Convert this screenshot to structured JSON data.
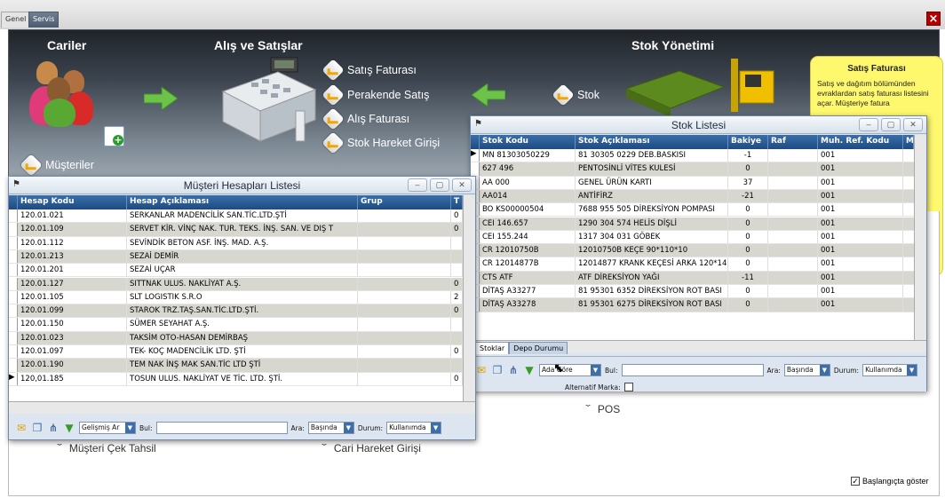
{
  "tabs": [
    {
      "label": "Genel"
    },
    {
      "label": "Servis"
    }
  ],
  "hero": {
    "cariler": "Cariler",
    "alis_satis": "Alış ve Satışlar",
    "stok_yonetimi": "Stok Yönetimi",
    "musteriler": "Müşteriler",
    "menu": [
      "Satış Faturası",
      "Perakende Satış",
      "Alış Faturası",
      "Stok Hareket Girişi"
    ],
    "stok": "Stok",
    "info_title": "Satış Faturası",
    "info_text": "Satış ve dağıtım bölümünden evraklardan satış faturası listesini açar. Müşteriye fatura"
  },
  "hidden_labels": {
    "left": "Müşteri Çek Tahsil",
    "mid": "Cari Hareket Girişi",
    "pos": "POS"
  },
  "musteri_window": {
    "title": "Müşteri Hesapları Listesi",
    "columns": [
      "Hesap Kodu",
      "Hesap Açıklaması",
      "Grup",
      "T"
    ],
    "rows": [
      [
        "120.01.021",
        "SERKANLAR MADENCİLİK SAN.TİC.LTD.ŞTİ",
        "",
        "0"
      ],
      [
        "120.01.109",
        "SERVET KİR. VİNÇ NAK. TUR. TEKS. İNŞ. SAN. VE DIŞ T",
        "",
        "0"
      ],
      [
        "120.01.112",
        "SEVİNDİK BETON ASF. İNŞ. MAD. A.Ş.",
        "",
        ""
      ],
      [
        "120.01.213",
        "SEZAİ DEMİR",
        "",
        ""
      ],
      [
        "120.01.201",
        "SEZAİ UÇAR",
        "",
        ""
      ],
      [
        "120.01.127",
        "SITTNAK ULUS. NAKLİYAT A.Ş.",
        "",
        "0"
      ],
      [
        "120.01.105",
        "SLT LOGISTIK S.R.O",
        "",
        "2"
      ],
      [
        "120.01.099",
        "STAROK TRZ.TAŞ.SAN.TİC.LTD.ŞTİ.",
        "",
        "0"
      ],
      [
        "120.01.150",
        "SÜMER SEYAHAT A.Ş.",
        "",
        ""
      ],
      [
        "120.01.023",
        "TAKSİM OTO-HASAN DEMİRBAŞ",
        "",
        ""
      ],
      [
        "120.01.097",
        "TEK- KOÇ MADENCİLİK LTD. ŞTİ",
        "",
        "0"
      ],
      [
        "120.01.190",
        "TEM NAK İNŞ MAK SAN.TİC LTD ŞTİ",
        "",
        ""
      ],
      [
        "120,01.185",
        "TOSUN ULUS. NAKLİYAT VE TİC. LTD. ŞTİ.",
        "",
        "0"
      ]
    ],
    "filter_select": "Gelişmiş Ar",
    "bul_label": "Bul:",
    "ara_label": "Ara:",
    "ara_value": "Başında",
    "durum_label": "Durum:",
    "durum_value": "Kullanımda"
  },
  "stok_window": {
    "title": "Stok Listesi",
    "columns": [
      "Stok Kodu",
      "Stok Açıklaması",
      "Bakiye",
      "Raf",
      "Muh. Ref. Kodu",
      "M"
    ],
    "rows": [
      [
        "MN 81303050229",
        "81 30305 0229 DEB.BASKISI",
        "-1",
        "",
        "001"
      ],
      [
        "627 496",
        "PENTOSİNLİ VİTES KULESİ",
        "0",
        "",
        "001"
      ],
      [
        "AA 000",
        "GENEL ÜRÜN KARTI",
        "37",
        "",
        "001"
      ],
      [
        "AA014",
        "ANTİFİRZ",
        "-21",
        "",
        "001"
      ],
      [
        "BO KS00000504",
        "7688 955 505 DİREKSİYON POMPASI",
        "0",
        "",
        "001"
      ],
      [
        "CEI 146.657",
        "1290 304 574 HELİS DİŞLİ",
        "0",
        "",
        "001"
      ],
      [
        "CEI 155.244",
        "1317 304 031 GÖBEK",
        "0",
        "",
        "001"
      ],
      [
        "CR 12010750B",
        "12010750B KEÇE 90*110*10",
        "0",
        "",
        "001"
      ],
      [
        "CR 12014877B",
        "12014877 KRANK KEÇESİ ARKA 120*140",
        "0",
        "",
        "001"
      ],
      [
        "CTS ATF",
        "ATF DİREKSİYON YAĞI",
        "-11",
        "",
        "001"
      ],
      [
        "DİTAŞ A33277",
        "81 95301 6352 DİREKSİYON ROT BASI",
        "0",
        "",
        "001"
      ],
      [
        "DİTAŞ A33278",
        "81 95301 6275 DİREKSİYON ROT BASI",
        "0",
        "",
        "001"
      ]
    ],
    "subtabs": [
      "Stoklar",
      "Depo Durumu"
    ],
    "filter_select": "Ada Göre",
    "bul_label": "Bul:",
    "ara_label": "Ara:",
    "ara_value": "Başında",
    "durum_label": "Durum:",
    "durum_value": "Kullanımda",
    "alt_marka_label": "Alternatif Marka:"
  },
  "startup_label": "Başlangıçta göster"
}
